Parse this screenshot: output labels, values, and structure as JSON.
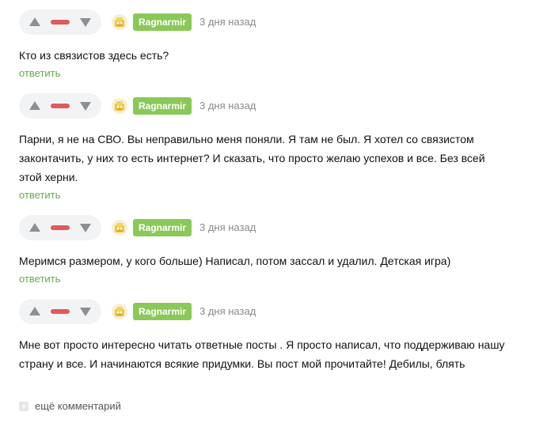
{
  "comments": [
    {
      "nick": "Ragnarmir",
      "time": "3 дня назад",
      "lines": [
        "Кто из связистов здесь есть?"
      ],
      "reply": "ответить"
    },
    {
      "nick": "Ragnarmir",
      "time": "3 дня назад",
      "lines": [
        "Парни, я не на СВО. Вы неправильно меня поняли. Я там не был. Я хотел со связистом",
        "законтачить, у них то есть интернет? И сказать, что просто желаю успехов и все. Без всей",
        "этой херни."
      ],
      "reply": "ответить"
    },
    {
      "nick": "Ragnarmir",
      "time": "3 дня назад",
      "lines": [
        "Меримся размером, у кого больше) Написал, потом зассал и удалил. Детская игра)"
      ],
      "reply": "ответить"
    },
    {
      "nick": "Ragnarmir",
      "time": "3 дня назад",
      "lines": [
        "Мне вот просто интересно читать ответные посты . Я просто написал, что поддерживаю нашу",
        "страну и все. И начинаются всякие придумки. Вы пост мой прочитайте! Дебилы, блять"
      ],
      "reply": "ответить"
    }
  ],
  "more_comments": "ещё комментарий",
  "icons": {
    "vote_up": "arrow-up-icon",
    "vote_down": "arrow-down-icon",
    "avatar": "avatar-icon",
    "more": "expand-icon"
  },
  "colors": {
    "nick_badge": "#8ac858",
    "reply_link": "#6aa84f",
    "rating_negative": "#e05a5a",
    "vote_pill": "#f2f3f5",
    "arrow": "#8f8f8f",
    "time": "#8a8a8a"
  }
}
